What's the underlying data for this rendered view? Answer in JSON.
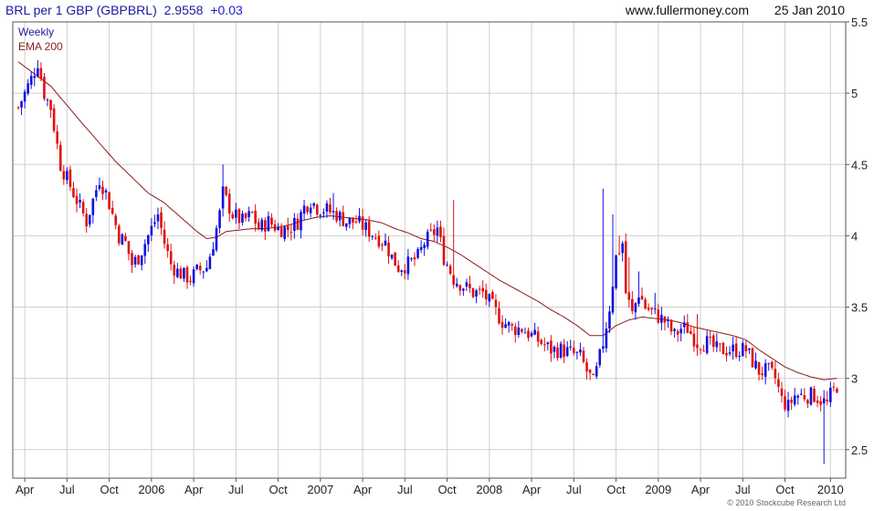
{
  "header": {
    "symbol": "BRL  per 1 GBP (GBPBRL)",
    "last": "2.9558",
    "change": "+0.03",
    "site": "www.fullermoney.com",
    "date": "25 Jan 2010"
  },
  "legend": {
    "period": "Weekly",
    "ema": "EMA 200"
  },
  "copyright": "© 2010 Stockcube Research Ltd",
  "colors": {
    "up": "#1010e0",
    "down": "#e01010",
    "ema": "#8b1a1a",
    "grid": "#cfcfcf",
    "header_blue": "#1a1aa0",
    "change_blue": "#1a1acc"
  },
  "chart_data": {
    "type": "candlestick",
    "frequency": "weekly",
    "yticks": [
      "2.5",
      "3",
      "3.5",
      "4",
      "4.5",
      "5",
      "5.5"
    ],
    "ylim": [
      2.3,
      5.5
    ],
    "xticks": [
      "Apr",
      "Jul",
      "Oct",
      "2006",
      "Apr",
      "Jul",
      "Oct",
      "2007",
      "Apr",
      "Jul",
      "Oct",
      "2008",
      "Apr",
      "Jul",
      "Oct",
      "2009",
      "Apr",
      "Jul",
      "Oct",
      "2010"
    ],
    "xlim": [
      0,
      253
    ],
    "xtick_weeks": [
      2,
      15,
      28,
      41,
      54,
      67,
      80,
      93,
      106,
      119,
      132,
      145,
      158,
      171,
      184,
      197,
      210,
      223,
      236,
      250
    ],
    "close_anchors": [
      [
        0,
        4.9
      ],
      [
        4,
        5.1
      ],
      [
        6,
        5.22
      ],
      [
        8,
        5.0
      ],
      [
        10,
        4.9
      ],
      [
        13,
        4.5
      ],
      [
        16,
        4.35
      ],
      [
        19,
        4.2
      ],
      [
        21,
        4.1
      ],
      [
        23,
        4.25
      ],
      [
        25,
        4.4
      ],
      [
        27,
        4.3
      ],
      [
        29,
        4.15
      ],
      [
        31,
        4.0
      ],
      [
        33,
        3.95
      ],
      [
        35,
        3.8
      ],
      [
        37,
        3.85
      ],
      [
        39,
        3.95
      ],
      [
        41,
        4.05
      ],
      [
        43,
        4.15
      ],
      [
        45,
        3.95
      ],
      [
        47,
        3.8
      ],
      [
        49,
        3.75
      ],
      [
        51,
        3.72
      ],
      [
        53,
        3.7
      ],
      [
        55,
        3.75
      ],
      [
        58,
        3.78
      ],
      [
        60,
        3.95
      ],
      [
        62,
        4.15
      ],
      [
        63,
        4.3
      ],
      [
        64,
        4.25
      ],
      [
        66,
        4.15
      ],
      [
        69,
        4.1
      ],
      [
        72,
        4.15
      ],
      [
        74,
        4.05
      ],
      [
        77,
        4.1
      ],
      [
        80,
        4.05
      ],
      [
        83,
        4.05
      ],
      [
        86,
        4.1
      ],
      [
        88,
        4.2
      ],
      [
        90,
        4.25
      ],
      [
        92,
        4.2
      ],
      [
        95,
        4.18
      ],
      [
        98,
        4.15
      ],
      [
        101,
        4.1
      ],
      [
        104,
        4.1
      ],
      [
        107,
        4.05
      ],
      [
        110,
        4.0
      ],
      [
        113,
        3.95
      ],
      [
        115,
        3.85
      ],
      [
        117,
        3.78
      ],
      [
        120,
        3.8
      ],
      [
        123,
        3.85
      ],
      [
        125,
        3.95
      ],
      [
        127,
        4.0
      ],
      [
        129,
        4.05
      ],
      [
        131,
        3.85
      ],
      [
        134,
        3.7
      ],
      [
        137,
        3.65
      ],
      [
        140,
        3.6
      ],
      [
        143,
        3.6
      ],
      [
        146,
        3.5
      ],
      [
        149,
        3.4
      ],
      [
        152,
        3.35
      ],
      [
        155,
        3.35
      ],
      [
        158,
        3.3
      ],
      [
        161,
        3.25
      ],
      [
        164,
        3.2
      ],
      [
        167,
        3.2
      ],
      [
        170,
        3.18
      ],
      [
        173,
        3.15
      ],
      [
        175,
        3.05
      ],
      [
        177,
        2.97
      ],
      [
        178,
        3.05
      ],
      [
        180,
        3.25
      ],
      [
        182,
        3.5
      ],
      [
        184,
        3.85
      ],
      [
        186,
        3.95
      ],
      [
        187,
        3.6
      ],
      [
        189,
        3.45
      ],
      [
        191,
        3.6
      ],
      [
        193,
        3.5
      ],
      [
        196,
        3.45
      ],
      [
        199,
        3.4
      ],
      [
        202,
        3.3
      ],
      [
        204,
        3.35
      ],
      [
        206,
        3.35
      ],
      [
        209,
        3.25
      ],
      [
        212,
        3.25
      ],
      [
        215,
        3.2
      ],
      [
        218,
        3.2
      ],
      [
        221,
        3.2
      ],
      [
        224,
        3.2
      ],
      [
        226,
        3.12
      ],
      [
        228,
        3.05
      ],
      [
        231,
        3.05
      ],
      [
        233,
        3.0
      ],
      [
        235,
        2.85
      ],
      [
        237,
        2.8
      ],
      [
        239,
        2.88
      ],
      [
        242,
        2.88
      ],
      [
        245,
        2.88
      ],
      [
        247,
        2.85
      ],
      [
        249,
        2.82
      ],
      [
        250,
        2.88
      ],
      [
        252,
        2.95
      ]
    ],
    "spikes": [
      [
        63,
        4.5
      ],
      [
        97,
        4.3
      ],
      [
        134,
        4.25
      ],
      [
        180,
        4.33
      ],
      [
        183,
        4.15
      ],
      [
        185,
        4.0
      ],
      [
        188,
        3.85
      ],
      [
        191,
        3.75
      ],
      [
        196,
        3.6
      ],
      [
        209,
        3.45
      ],
      [
        231,
        3.1
      ],
      [
        248,
        2.4
      ]
    ],
    "ema": [
      [
        0,
        5.22
      ],
      [
        10,
        5.05
      ],
      [
        20,
        4.78
      ],
      [
        30,
        4.52
      ],
      [
        40,
        4.3
      ],
      [
        45,
        4.23
      ],
      [
        50,
        4.13
      ],
      [
        55,
        4.03
      ],
      [
        58,
        3.98
      ],
      [
        61,
        3.99
      ],
      [
        64,
        4.03
      ],
      [
        68,
        4.04
      ],
      [
        72,
        4.05
      ],
      [
        76,
        4.05
      ],
      [
        80,
        4.06
      ],
      [
        84,
        4.08
      ],
      [
        88,
        4.11
      ],
      [
        92,
        4.13
      ],
      [
        96,
        4.14
      ],
      [
        100,
        4.13
      ],
      [
        104,
        4.12
      ],
      [
        108,
        4.11
      ],
      [
        112,
        4.09
      ],
      [
        116,
        4.05
      ],
      [
        120,
        4.02
      ],
      [
        124,
        3.98
      ],
      [
        128,
        3.96
      ],
      [
        132,
        3.92
      ],
      [
        136,
        3.87
      ],
      [
        140,
        3.81
      ],
      [
        144,
        3.75
      ],
      [
        148,
        3.69
      ],
      [
        152,
        3.64
      ],
      [
        156,
        3.59
      ],
      [
        160,
        3.54
      ],
      [
        164,
        3.48
      ],
      [
        168,
        3.43
      ],
      [
        172,
        3.37
      ],
      [
        176,
        3.3
      ],
      [
        180,
        3.3
      ],
      [
        184,
        3.37
      ],
      [
        188,
        3.41
      ],
      [
        192,
        3.43
      ],
      [
        196,
        3.42
      ],
      [
        200,
        3.41
      ],
      [
        204,
        3.39
      ],
      [
        208,
        3.36
      ],
      [
        212,
        3.34
      ],
      [
        216,
        3.32
      ],
      [
        220,
        3.3
      ],
      [
        224,
        3.27
      ],
      [
        228,
        3.2
      ],
      [
        232,
        3.14
      ],
      [
        236,
        3.08
      ],
      [
        240,
        3.04
      ],
      [
        244,
        3.01
      ],
      [
        248,
        2.99
      ],
      [
        252,
        3.0
      ]
    ]
  }
}
